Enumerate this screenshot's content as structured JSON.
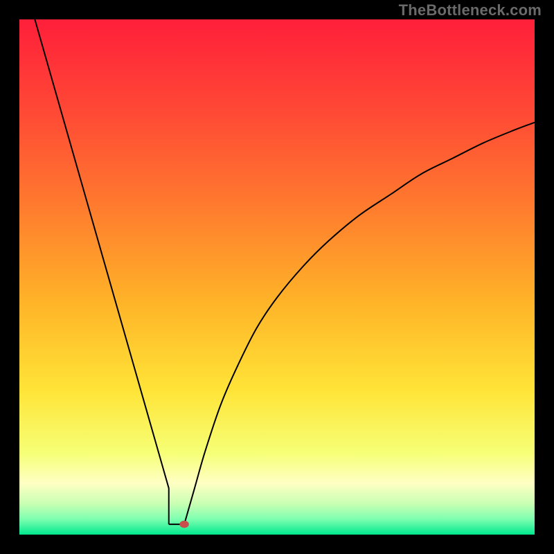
{
  "watermark": "TheBottleneck.com",
  "colors": {
    "bg": "#000000",
    "watermark_text": "#6a6a6a",
    "gradient_stops": [
      {
        "offset": 0.0,
        "color": "#ff1f3a"
      },
      {
        "offset": 0.18,
        "color": "#ff4935"
      },
      {
        "offset": 0.36,
        "color": "#ff7a2e"
      },
      {
        "offset": 0.55,
        "color": "#ffb428"
      },
      {
        "offset": 0.72,
        "color": "#ffe437"
      },
      {
        "offset": 0.84,
        "color": "#f6ff75"
      },
      {
        "offset": 0.9,
        "color": "#ffffc3"
      },
      {
        "offset": 0.94,
        "color": "#c9ffb3"
      },
      {
        "offset": 0.97,
        "color": "#7dffb0"
      },
      {
        "offset": 1.0,
        "color": "#00e88e"
      }
    ],
    "curve": "#000000",
    "marker": "#c84d4d"
  },
  "chart_data": {
    "type": "line",
    "title": "",
    "xlabel": "",
    "ylabel": "",
    "xlim": [
      0,
      100
    ],
    "ylim": [
      0,
      100
    ],
    "marker": {
      "x": 32,
      "y": 2
    },
    "short_floor": {
      "x_start": 29,
      "x_end": 32,
      "y": 2
    },
    "series": [
      {
        "name": "left-branch",
        "x": [
          3,
          5,
          8,
          11,
          14,
          17,
          20,
          23,
          26,
          29
        ],
        "y": [
          100,
          93,
          82.5,
          72,
          61.5,
          51,
          40.5,
          30,
          19.5,
          9
        ]
      },
      {
        "name": "right-branch",
        "x": [
          32,
          34,
          36,
          39,
          42,
          46,
          50,
          55,
          60,
          66,
          72,
          78,
          84,
          90,
          96,
          100
        ],
        "y": [
          2,
          9,
          16,
          25,
          32,
          40,
          46,
          52,
          57,
          62,
          66,
          70,
          73,
          76,
          78.5,
          80
        ]
      }
    ]
  }
}
